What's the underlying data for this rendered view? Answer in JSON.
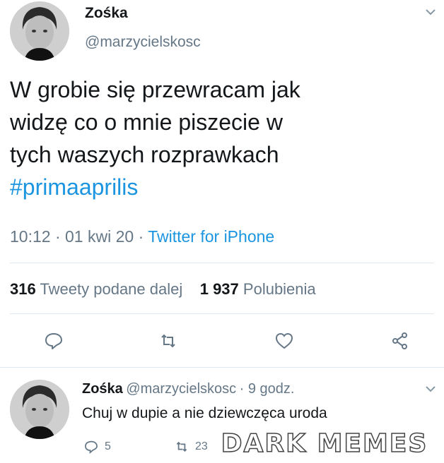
{
  "tweet": {
    "name": "Zośka",
    "handle": "@marzycielskosc",
    "text_lines": [
      "W grobie się przewracam jak",
      "widzę co o mnie piszecie w",
      "tych waszych rozprawkach"
    ],
    "hashtag": "#primaaprilis",
    "time": "10:12",
    "date": "01 kwi 20",
    "source": "Twitter for iPhone",
    "retweets_count": "316",
    "retweets_label": "Tweety podane dalej",
    "likes_count": "1 937",
    "likes_label": "Polubienia"
  },
  "reply": {
    "name": "Zośka",
    "handle": "@marzycielskosc",
    "age": "9 godz.",
    "text": "Chuj w dupie a nie dziewczęca uroda",
    "replies": "5",
    "retweets": "23"
  },
  "watermark": "DARK MEMES",
  "icons": {
    "reply": "comment-icon",
    "retweet": "retweet-icon",
    "like": "heart-icon",
    "share": "share-icon",
    "menu": "chevron-down-icon"
  },
  "colors": {
    "link": "#1b95e0",
    "secondary": "#657786",
    "divider": "#e1e8ed"
  }
}
